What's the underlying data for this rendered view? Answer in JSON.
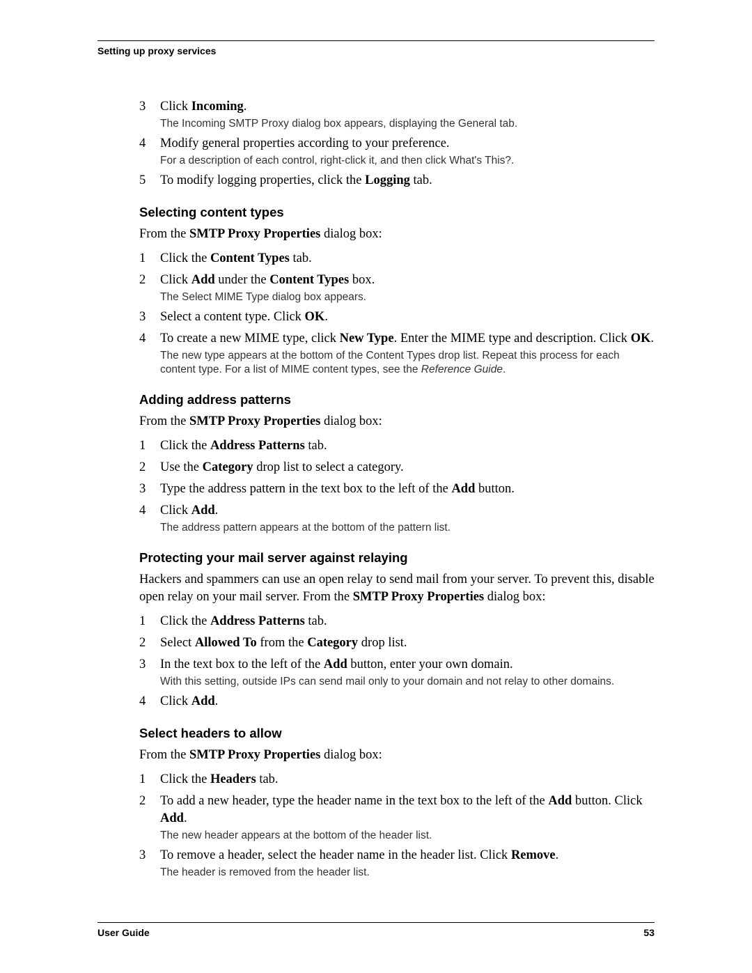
{
  "header": {
    "running_title": "Setting up proxy services"
  },
  "intro_steps": [
    {
      "n": "3",
      "text_pre": "Click ",
      "bold": "Incoming",
      "text_post": ".",
      "result": "The Incoming SMTP Proxy dialog box appears, displaying the General tab."
    },
    {
      "n": "4",
      "text_pre": "Modify general properties according to your preference.",
      "bold": "",
      "text_post": "",
      "result": "For a description of each control, right-click it, and then click What's This?."
    },
    {
      "n": "5",
      "text_pre": "To modify logging properties, click the ",
      "bold": "Logging",
      "text_post": " tab.",
      "result": ""
    }
  ],
  "sections": [
    {
      "title": "Selecting content types",
      "lead_pre": "From the ",
      "lead_bold": "SMTP Proxy Properties",
      "lead_post": " dialog box:",
      "steps": [
        {
          "n": "1",
          "html": "Click the <span class='b'>Content Types</span> tab.",
          "result": ""
        },
        {
          "n": "2",
          "html": "Click <span class='b'>Add</span> under the <span class='b'>Content Types</span> box.",
          "result": "The Select MIME Type dialog box appears."
        },
        {
          "n": "3",
          "html": "Select a content type. Click <span class='b'>OK</span>.",
          "result": ""
        },
        {
          "n": "4",
          "html": "To create a new MIME type, click <span class='b'>New Type</span>. Enter the MIME type and description. Click <span class='b'>OK</span>.",
          "result": "The new type appears at the bottom of the Content Types drop list. Repeat this process for each content type. For a list of MIME content types, see the <span class='ital'>Reference Guide</span>."
        }
      ]
    },
    {
      "title": "Adding address patterns",
      "lead_pre": "From the ",
      "lead_bold": "SMTP Proxy Properties",
      "lead_post": " dialog box:",
      "steps": [
        {
          "n": "1",
          "html": "Click the <span class='b'>Address Patterns</span> tab.",
          "result": ""
        },
        {
          "n": "2",
          "html": "Use the <span class='b'>Category</span> drop list to select a category.",
          "result": ""
        },
        {
          "n": "3",
          "html": "Type the address pattern in the text box to the left of the <span class='b'>Add</span> button.",
          "result": ""
        },
        {
          "n": "4",
          "html": "Click <span class='b'>Add</span>.",
          "result": "The address pattern appears at the bottom of the pattern list."
        }
      ]
    },
    {
      "title": "Protecting your mail server against relaying",
      "lead_html": "Hackers and spammers can use an open relay to send mail from your server. To prevent this, disable open relay on your mail server. From the <span class='b'>SMTP Proxy Properties</span> dialog box:",
      "steps": [
        {
          "n": "1",
          "html": "Click the <span class='b'>Address Patterns</span> tab.",
          "result": ""
        },
        {
          "n": "2",
          "html": "Select <span class='b'>Allowed To</span> from the <span class='b'>Category</span> drop list.",
          "result": ""
        },
        {
          "n": "3",
          "html": "In the text box to the left of the <span class='b'>Add</span> button, enter your own domain.",
          "result": "With this setting, outside IPs can send mail only to your domain and not relay to other domains."
        },
        {
          "n": "4",
          "html": "Click <span class='b'>Add</span>.",
          "result": ""
        }
      ]
    },
    {
      "title": "Select headers to allow",
      "lead_pre": "From the ",
      "lead_bold": "SMTP Proxy Properties",
      "lead_post": " dialog box:",
      "steps": [
        {
          "n": "1",
          "html": "Click the <span class='b'>Headers</span> tab.",
          "result": ""
        },
        {
          "n": "2",
          "html": "To add a new header, type the header name in the text box to the left of the <span class='b'>Add</span> button. Click <span class='b'>Add</span>.",
          "result": "The new header appears at the bottom of the header list."
        },
        {
          "n": "3",
          "html": "To remove a header, select the header name in the header list. Click <span class='b'>Remove</span>.",
          "result": "The header is removed from the header list."
        }
      ]
    }
  ],
  "footer": {
    "left": "User Guide",
    "right": "53"
  }
}
